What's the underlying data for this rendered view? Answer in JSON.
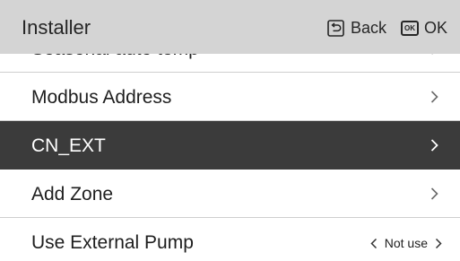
{
  "header": {
    "title": "Installer",
    "back_label": "Back",
    "ok_icon_text": "OK",
    "ok_label": "OK",
    "back_icon": "back-return-icon",
    "ok_icon": "ok-key-icon",
    "background": "#d4d4d4"
  },
  "menu": {
    "items": [
      {
        "label": "Seasonal auto temp",
        "selected": false,
        "partially_visible": true
      },
      {
        "label": "Modbus Address",
        "selected": false
      },
      {
        "label": "CN_EXT",
        "selected": true
      },
      {
        "label": "Add Zone",
        "selected": false
      },
      {
        "label": "Use External Pump",
        "selected": false,
        "value": "Not use"
      }
    ],
    "selected_background": "#3b3b3b",
    "chevron_icon": "chevron-right-icon"
  }
}
